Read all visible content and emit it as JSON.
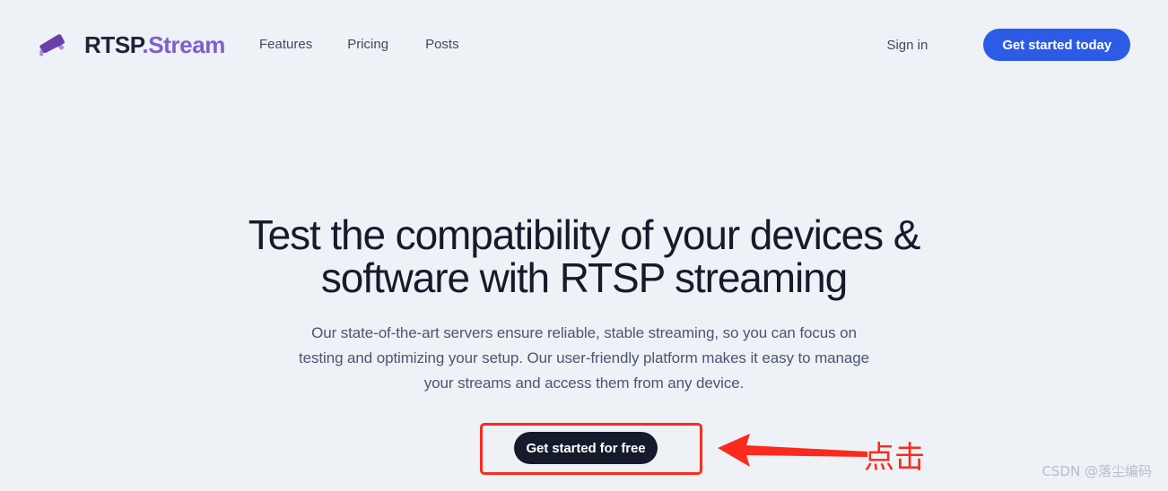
{
  "header": {
    "logo": {
      "icon": "security-camera-icon",
      "text_primary": "RTSP",
      "text_accent": ".Stream"
    },
    "nav_items": [
      {
        "label": "Features"
      },
      {
        "label": "Pricing"
      },
      {
        "label": "Posts"
      }
    ],
    "sign_in_label": "Sign in",
    "cta_label": "Get started today"
  },
  "hero": {
    "title_line1": "Test the compatibility of your devices &",
    "title_line2": "software with RTSP streaming",
    "subtitle_line1": "Our state-of-the-art servers ensure reliable, stable streaming, so you can focus on",
    "subtitle_line2": "testing and optimizing your setup. Our user-friendly platform makes it easy to manage",
    "subtitle_line3": "your streams and access them from any device.",
    "cta_label": "Get started for free"
  },
  "annotation": {
    "arrow": "left-arrow-icon",
    "label": "点击",
    "color": "#fb2a1c"
  },
  "watermark": {
    "text": "CSDN @落尘编码"
  },
  "colors": {
    "page_background": "#eef1f6",
    "brand_accent": "#7e5fd0",
    "primary_button": "#2c5ce6",
    "dark_button": "#151b2b",
    "heading": "#151b2b",
    "body_text": "#4b5670",
    "annotation_red": "#fb2a1c"
  }
}
